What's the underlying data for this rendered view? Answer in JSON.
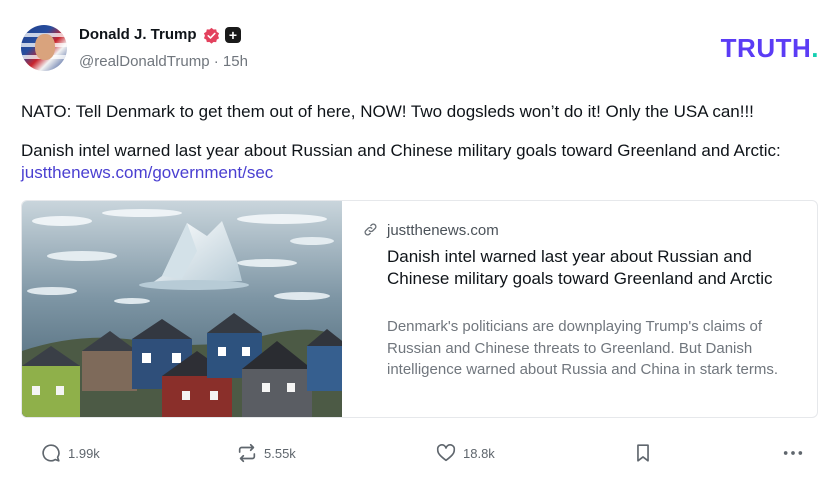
{
  "author": {
    "name": "Donald J. Trump",
    "handle": "@realDonaldTrump",
    "separator": "·",
    "time": "15h",
    "plus_badge": "+"
  },
  "brand": {
    "logo_text": "TRUTH",
    "logo_dot": ".",
    "accent": "#5b3cf5",
    "dot_color": "#14cfb0"
  },
  "post": {
    "paragraph1": "NATO: Tell Denmark to get them out of here, NOW! Two dogsleds won’t do it! Only the USA can!!!",
    "paragraph2_prefix": "Danish intel warned last year about Russian and Chinese military goals toward Greenland and Arctic: ",
    "paragraph2_link": "justthenews.com/government/sec"
  },
  "card": {
    "domain": "justthenews.com",
    "title": "Danish intel warned last year about Russian and Chinese military goals toward Greenland and Arctic",
    "description": "Denmark's politicians are downplaying Trump's claims of Russian and Chinese threats to Greenland. But Danish intelligence warned about Russia and China in stark terms."
  },
  "actions": {
    "replies": "1.99k",
    "retruths": "5.55k",
    "likes": "18.8k"
  },
  "colors": {
    "verified_badge": "#e3425e",
    "link": "#4a3fd1",
    "muted": "#70767d"
  }
}
